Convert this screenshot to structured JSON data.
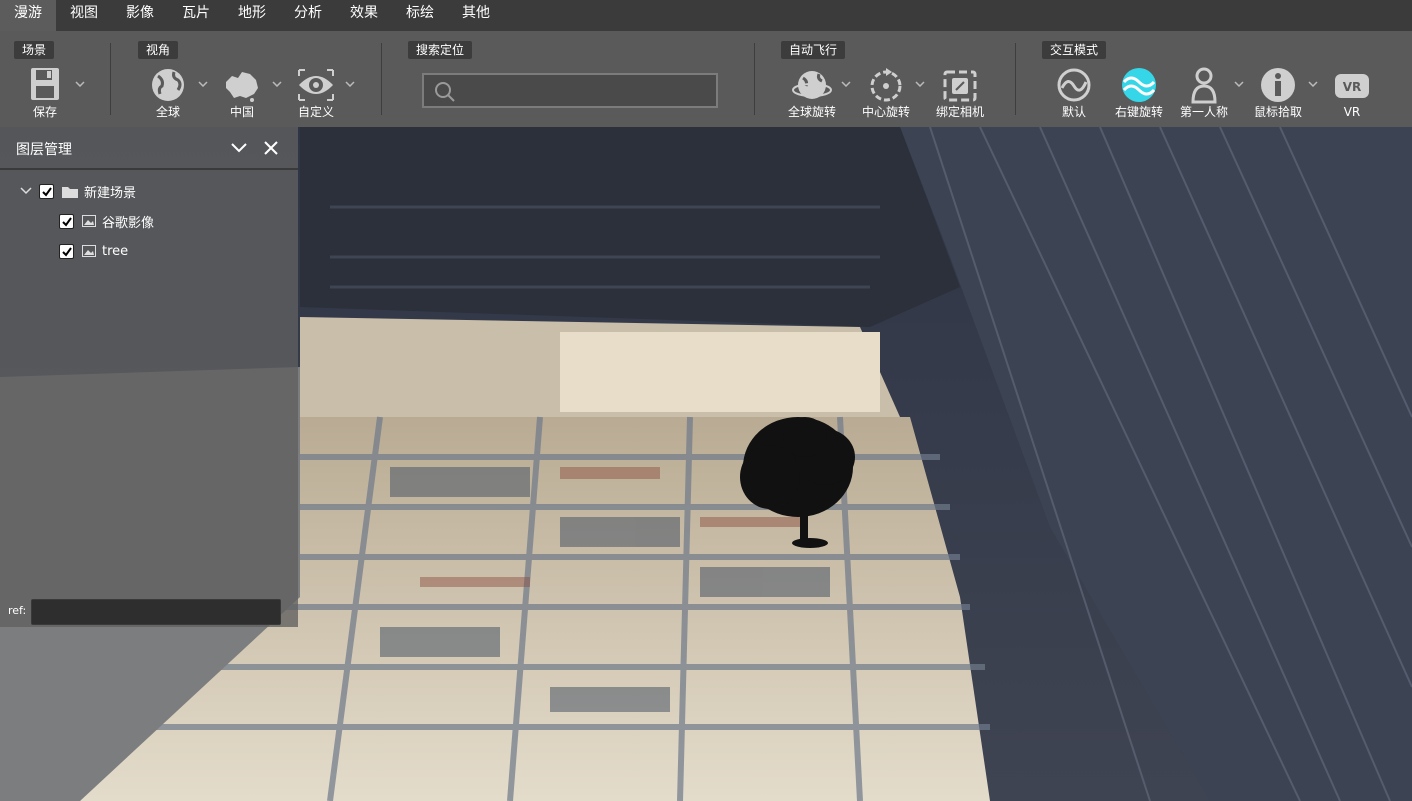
{
  "menu": {
    "tabs": [
      {
        "label": "漫游",
        "active": true
      },
      {
        "label": "视图"
      },
      {
        "label": "影像"
      },
      {
        "label": "瓦片"
      },
      {
        "label": "地形"
      },
      {
        "label": "分析"
      },
      {
        "label": "效果"
      },
      {
        "label": "标绘"
      },
      {
        "label": "其他"
      }
    ]
  },
  "ribbon": {
    "groups": {
      "scene": "场景",
      "view_angle": "视角",
      "search": "搜索定位",
      "auto_fly": "自动飞行",
      "interaction": "交互模式"
    },
    "tools": {
      "save": "保存",
      "global": "全球",
      "china": "中国",
      "custom": "自定义",
      "global_rotate": "全球旋转",
      "center_rotate": "中心旋转",
      "bind_camera": "绑定相机",
      "default_mode": "默认",
      "right_drag_rotate": "右键旋转",
      "first_person": "第一人称",
      "mouse_pick": "鼠标拾取",
      "vr": "VR"
    },
    "search": {
      "value": "",
      "placeholder": ""
    }
  },
  "layer_panel": {
    "title": "图层管理",
    "tree": [
      {
        "label": "新建场景",
        "checked": true,
        "icon": "folder-icon",
        "expanded": true
      },
      {
        "label": "谷歌影像",
        "checked": true,
        "icon": "image-layer-icon"
      },
      {
        "label": "tree",
        "checked": true,
        "icon": "image-layer-icon"
      }
    ],
    "ref_label": "ref:",
    "ref_value": ""
  },
  "colors": {
    "menubar_bg": "#3b3b3b",
    "ribbon_bg": "#5a5a5a",
    "active_tool": "#35d6e8",
    "panel_bg": "#606060"
  }
}
